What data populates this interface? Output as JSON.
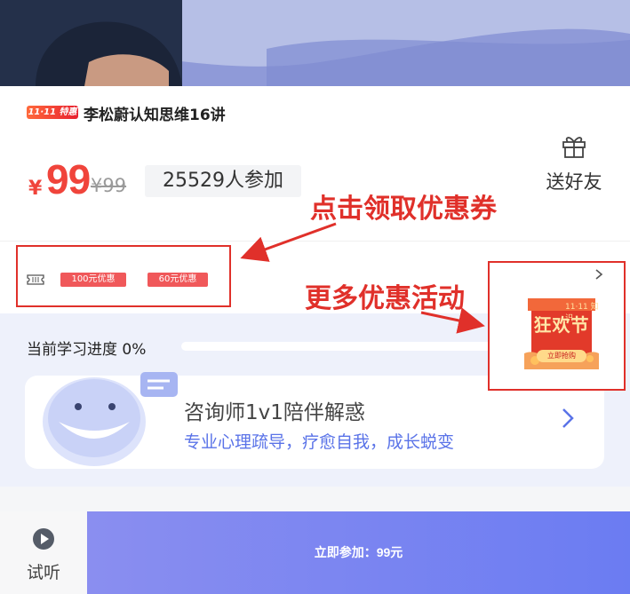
{
  "course": {
    "promo_tag": "11·11 特惠",
    "title": "李松蔚认知思维16讲",
    "price_symbol": "¥",
    "price": "99",
    "original_price": "¥99",
    "participants": "25529人参加",
    "gift_label": "送好友"
  },
  "coupons": [
    "100元优惠",
    "60元优惠"
  ],
  "activity": {
    "small_text": "11·11 知识",
    "title": "狂欢节",
    "button": "立即抢购"
  },
  "progress": {
    "label": "当前学习进度 0%",
    "value": 0
  },
  "consult": {
    "title": "咨询师1v1陪伴解惑",
    "subtitle": "专业心理疏导，疗愈自我，成长蜕变"
  },
  "bottom": {
    "trial_label": "试听",
    "join_label": "立即参加：99元"
  },
  "annotations": {
    "coupon_hint": "点击领取优惠券",
    "more_promo_hint": "更多优惠活动"
  },
  "colors": {
    "accent_red": "#f0443b",
    "annotation_red": "#e0302a",
    "brand_blue": "#6b7cf2"
  },
  "icons": [
    "gift-icon",
    "ticket-icon",
    "chevron-right-icon",
    "play-icon",
    "whale-mascot-icon",
    "chat-bubble-icon"
  ]
}
